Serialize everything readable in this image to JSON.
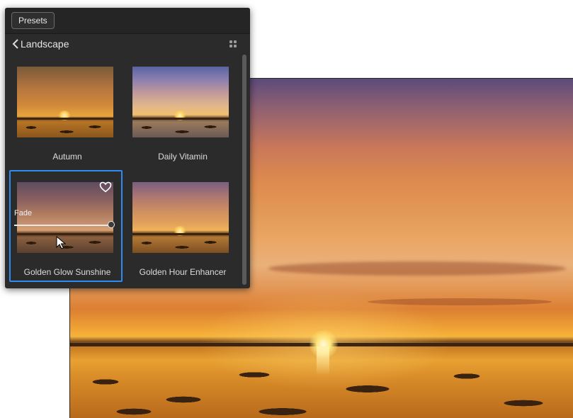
{
  "panel": {
    "presets_button": "Presets",
    "category_title": "Landscape",
    "back_icon": "chevron-left-icon",
    "view_icon": "grid-view-icon"
  },
  "presets": [
    {
      "label": "Autumn",
      "selected": false
    },
    {
      "label": "Daily Vitamin",
      "selected": false
    },
    {
      "label": "Golden Glow Sunshine",
      "selected": true,
      "favorite_icon": "heart-icon"
    },
    {
      "label": "Golden Hour Enhancer",
      "selected": false
    }
  ],
  "fade_slider": {
    "label": "Fade",
    "value": 1.0
  },
  "colors": {
    "selection_accent": "#2d8cf0",
    "panel_bg": "#2b2b2b"
  }
}
